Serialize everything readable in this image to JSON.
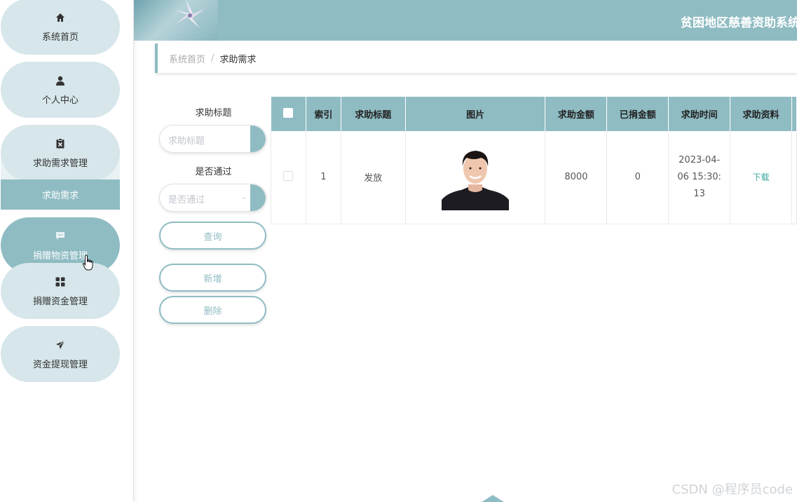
{
  "app": {
    "title": "贫困地区慈善资助系统"
  },
  "sidebar": {
    "items": [
      {
        "label": "系统首页",
        "icon": "home-icon"
      },
      {
        "label": "个人中心",
        "icon": "user-icon"
      },
      {
        "label": "求助需求管理",
        "icon": "clipboard-icon"
      },
      {
        "label": "捐赠物资管理",
        "icon": "chat-icon"
      },
      {
        "label": "捐赠资金管理",
        "icon": "grid-icon"
      },
      {
        "label": "资金提现管理",
        "icon": "send-icon"
      }
    ],
    "submenu": {
      "label": "求助需求"
    }
  },
  "breadcrumb": {
    "home": "系统首页",
    "separator": "/",
    "current": "求助需求"
  },
  "search": {
    "title_label": "求助标题",
    "title_placeholder": "求助标题",
    "approved_label": "是否通过",
    "approved_placeholder": "是否通过",
    "query_button": "查询",
    "add_button": "新增",
    "delete_button": "删除"
  },
  "table": {
    "headers": [
      "索引",
      "求助标题",
      "图片",
      "求助金额",
      "已捐金额",
      "求助时间",
      "求助资料"
    ],
    "rows": [
      {
        "index": "1",
        "title": "发放",
        "amount": "8000",
        "donated": "0",
        "time_line1": "2023-04-",
        "time_line2": "06 15:30:",
        "time_line3": "13",
        "material": "下载"
      }
    ]
  },
  "watermark": "CSDN @程序员code",
  "colors": {
    "accent": "#8fbcc3",
    "pill": "#d6e6ea",
    "link": "#3fa8a0"
  }
}
